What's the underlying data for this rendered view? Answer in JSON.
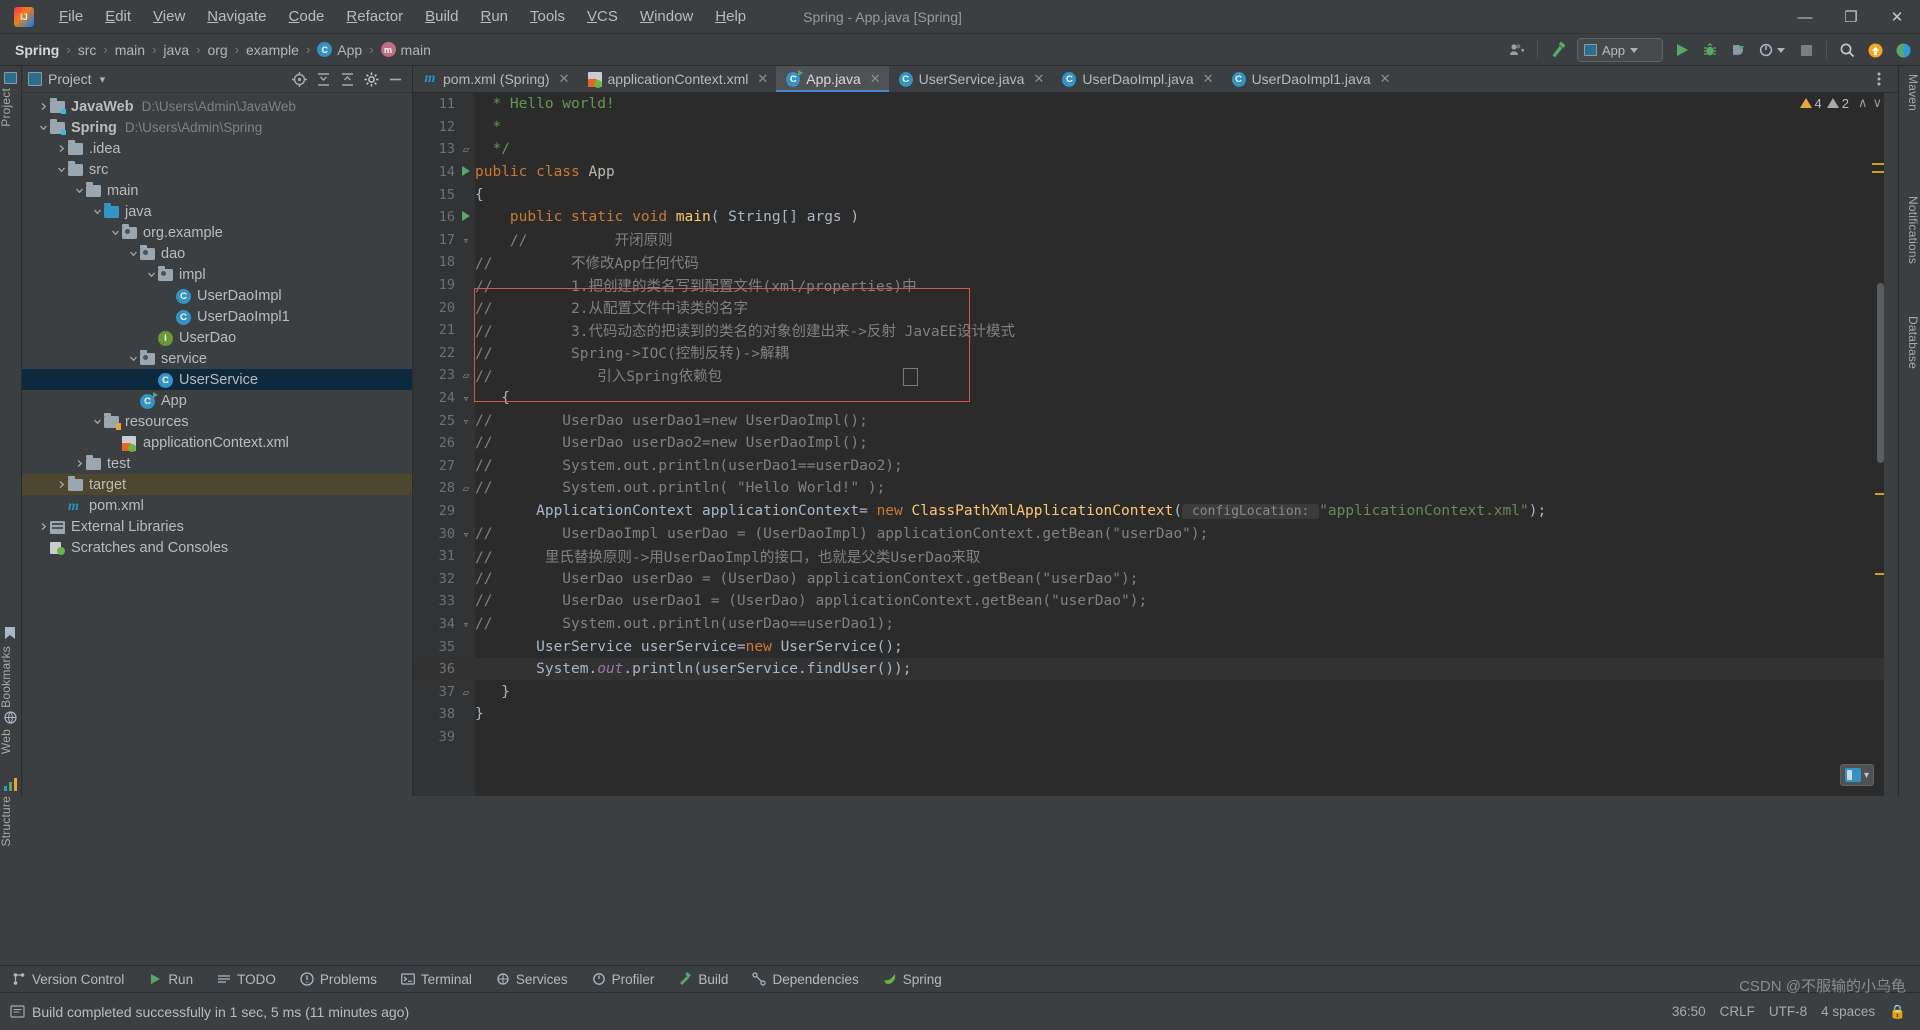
{
  "titlebar": {
    "logo": "intellij-logo",
    "menus": [
      "File",
      "Edit",
      "View",
      "Navigate",
      "Code",
      "Refactor",
      "Build",
      "Run",
      "Tools",
      "VCS",
      "Window",
      "Help"
    ],
    "window_title": "Spring - App.java [Spring]",
    "minimize": "—",
    "maximize": "❐",
    "close": "✕"
  },
  "breadcrumb": {
    "items": [
      {
        "label": "Spring",
        "bold": true,
        "icon": ""
      },
      {
        "label": "src",
        "bold": false,
        "icon": ""
      },
      {
        "label": "main",
        "bold": false,
        "icon": ""
      },
      {
        "label": "java",
        "bold": false,
        "icon": ""
      },
      {
        "label": "org",
        "bold": false,
        "icon": ""
      },
      {
        "label": "example",
        "bold": false,
        "icon": ""
      },
      {
        "label": "App",
        "bold": false,
        "icon": "class-icon"
      },
      {
        "label": "main",
        "bold": false,
        "icon": "method-icon"
      }
    ],
    "separator": "›"
  },
  "toolbar": {
    "user_icon": "user-dropdown-icon",
    "hammer_icon": "build-hammer-icon",
    "run_config": "App",
    "run_icon": "run-icon",
    "debug_icon": "debug-icon",
    "coverage_icon": "run-with-coverage-icon",
    "profiler_icon": "profiler-icon",
    "stop_icon": "stop-icon",
    "search_icon": "search-everywhere-icon",
    "updates_icon": "updates-icon",
    "settings_icon": "ide-settings-icon"
  },
  "left_strip": {
    "items": [
      "Project",
      "Bookmarks",
      "Web",
      "Structure"
    ]
  },
  "right_strip": {
    "items": [
      "Maven",
      "Notifications",
      "Database"
    ]
  },
  "project_panel": {
    "title": "Project",
    "chevron": "▾",
    "actions": [
      "locate-icon",
      "expand-all-icon",
      "collapse-all-icon",
      "settings-gear-icon",
      "hide-icon"
    ],
    "tree": [
      {
        "depth": 0,
        "label": "JavaWeb",
        "path": "D:\\Users\\Admin\\JavaWeb",
        "icon": "module-folder-icon",
        "arrow": "right",
        "bold": true
      },
      {
        "depth": 0,
        "label": "Spring",
        "path": "D:\\Users\\Admin\\Spring",
        "icon": "module-folder-icon",
        "arrow": "down",
        "bold": true
      },
      {
        "depth": 1,
        "label": ".idea",
        "path": "",
        "icon": "folder-icon",
        "arrow": "right",
        "bold": false
      },
      {
        "depth": 1,
        "label": "src",
        "path": "",
        "icon": "folder-icon",
        "arrow": "down",
        "bold": false
      },
      {
        "depth": 2,
        "label": "main",
        "path": "",
        "icon": "folder-icon",
        "arrow": "down",
        "bold": false
      },
      {
        "depth": 3,
        "label": "java",
        "path": "",
        "icon": "source-folder-icon",
        "arrow": "down",
        "bold": false
      },
      {
        "depth": 4,
        "label": "org.example",
        "path": "",
        "icon": "package-icon",
        "arrow": "down",
        "bold": false
      },
      {
        "depth": 5,
        "label": "dao",
        "path": "",
        "icon": "package-icon",
        "arrow": "down",
        "bold": false
      },
      {
        "depth": 6,
        "label": "impl",
        "path": "",
        "icon": "package-icon",
        "arrow": "down",
        "bold": false
      },
      {
        "depth": 7,
        "label": "UserDaoImpl",
        "path": "",
        "icon": "java-class-icon",
        "arrow": "none",
        "bold": false
      },
      {
        "depth": 7,
        "label": "UserDaoImpl1",
        "path": "",
        "icon": "java-class-icon",
        "arrow": "none",
        "bold": false
      },
      {
        "depth": 6,
        "label": "UserDao",
        "path": "",
        "icon": "java-interface-icon",
        "arrow": "none",
        "bold": false
      },
      {
        "depth": 5,
        "label": "service",
        "path": "",
        "icon": "package-icon",
        "arrow": "down",
        "bold": false
      },
      {
        "depth": 6,
        "label": "UserService",
        "path": "",
        "icon": "java-class-icon",
        "arrow": "none",
        "bold": false,
        "selected": true
      },
      {
        "depth": 5,
        "label": "App",
        "path": "",
        "icon": "java-runnable-class-icon",
        "arrow": "none",
        "bold": false
      },
      {
        "depth": 3,
        "label": "resources",
        "path": "",
        "icon": "resources-folder-icon",
        "arrow": "down",
        "bold": false
      },
      {
        "depth": 4,
        "label": "applicationContext.xml",
        "path": "",
        "icon": "spring-xml-icon",
        "arrow": "none",
        "bold": false
      },
      {
        "depth": 2,
        "label": "test",
        "path": "",
        "icon": "folder-icon",
        "arrow": "right",
        "bold": false
      },
      {
        "depth": 1,
        "label": "target",
        "path": "",
        "icon": "target-folder-icon",
        "arrow": "right",
        "bold": false,
        "highlight": true
      },
      {
        "depth": 1,
        "label": "pom.xml",
        "path": "",
        "icon": "maven-icon",
        "arrow": "none",
        "bold": false
      },
      {
        "depth": 0,
        "label": "External Libraries",
        "path": "",
        "icon": "libraries-icon",
        "arrow": "right",
        "bold": false
      },
      {
        "depth": 0,
        "label": "Scratches and Consoles",
        "path": "",
        "icon": "scratches-icon",
        "arrow": "none",
        "bold": false
      }
    ]
  },
  "editor": {
    "tabs": [
      {
        "label": "pom.xml (Spring)",
        "icon": "maven-icon",
        "active": false
      },
      {
        "label": "applicationContext.xml",
        "icon": "spring-xml-icon",
        "active": false
      },
      {
        "label": "App.java",
        "icon": "java-runnable-class-icon",
        "active": true
      },
      {
        "label": "UserService.java",
        "icon": "java-class-icon",
        "active": false
      },
      {
        "label": "UserDaoImpl.java",
        "icon": "java-class-icon",
        "active": false
      },
      {
        "label": "UserDaoImpl1.java",
        "icon": "java-class-icon",
        "active": false
      }
    ],
    "tab_close": "✕",
    "more_tabs_icon": "more-options-icon",
    "inspections": {
      "warnings": "4",
      "weak_warnings": "2",
      "up_icon": "∧",
      "down_icon": "∨"
    },
    "first_line_number": 11,
    "lines": [
      {
        "n": 11,
        "mark": "",
        "tokens": [
          {
            "t": "  * Hello world!",
            "c": "doc"
          }
        ]
      },
      {
        "n": 12,
        "mark": "",
        "tokens": [
          {
            "t": "  *",
            "c": "doc"
          }
        ]
      },
      {
        "n": 13,
        "mark": "fold-end",
        "tokens": [
          {
            "t": "  */",
            "c": "doc"
          }
        ]
      },
      {
        "n": 14,
        "mark": "run",
        "tokens": [
          {
            "t": "public class ",
            "c": "kw"
          },
          {
            "t": "App",
            "c": "cls-name"
          }
        ]
      },
      {
        "n": 15,
        "mark": "",
        "tokens": [
          {
            "t": "{",
            "c": "plain"
          }
        ]
      },
      {
        "n": 16,
        "mark": "run",
        "tokens": [
          {
            "t": "    ",
            "c": "plain"
          },
          {
            "t": "public static void ",
            "c": "kw"
          },
          {
            "t": "main",
            "c": "mth"
          },
          {
            "t": "( String[] args )",
            "c": "plain"
          }
        ]
      },
      {
        "n": 17,
        "mark": "fold-open",
        "tokens": [
          {
            "t": "    //          开闭原则",
            "c": "cmt"
          }
        ]
      },
      {
        "n": 18,
        "mark": "",
        "tokens": [
          {
            "t": "//         不修改App任何代码",
            "c": "cmt"
          }
        ]
      },
      {
        "n": 19,
        "mark": "",
        "tokens": [
          {
            "t": "//         1.把创建的类名写到配置文件(xml/properties)中",
            "c": "cmt"
          }
        ]
      },
      {
        "n": 20,
        "mark": "",
        "tokens": [
          {
            "t": "//         2.从配置文件中读类的名字",
            "c": "cmt"
          }
        ]
      },
      {
        "n": 21,
        "mark": "",
        "tokens": [
          {
            "t": "//         3.代码动态的把读到的类名的对象创建出来->反射 JavaEE设计模式",
            "c": "cmt"
          }
        ]
      },
      {
        "n": 22,
        "mark": "",
        "tokens": [
          {
            "t": "//         Spring->IOC(控制反转)->解耦",
            "c": "cmt"
          }
        ]
      },
      {
        "n": 23,
        "mark": "fold-end",
        "tokens": [
          {
            "t": "//            引入Spring依赖包",
            "c": "cmt"
          }
        ]
      },
      {
        "n": 24,
        "mark": "fold-open",
        "tokens": [
          {
            "t": "   {",
            "c": "plain"
          }
        ]
      },
      {
        "n": 25,
        "mark": "fold-open",
        "tokens": [
          {
            "t": "//        UserDao userDao1=new UserDaoImpl();",
            "c": "cmt"
          }
        ]
      },
      {
        "n": 26,
        "mark": "",
        "tokens": [
          {
            "t": "//        UserDao userDao2=new UserDaoImpl();",
            "c": "cmt"
          }
        ]
      },
      {
        "n": 27,
        "mark": "",
        "tokens": [
          {
            "t": "//        System.out.println(userDao1==userDao2);",
            "c": "cmt"
          }
        ]
      },
      {
        "n": 28,
        "mark": "fold-end",
        "tokens": [
          {
            "t": "//        System.out.println( \"Hello World!\" );",
            "c": "cmt"
          }
        ]
      },
      {
        "n": 29,
        "mark": "",
        "tokens": [
          {
            "t": "       ",
            "c": "plain"
          },
          {
            "t": "ApplicationContext",
            "c": "typ"
          },
          {
            "t": " applicationContext= ",
            "c": "plain"
          },
          {
            "t": "new ",
            "c": "kw"
          },
          {
            "t": "ClassPathXmlApplicationContext",
            "c": "mth"
          },
          {
            "t": "(",
            "c": "plain"
          },
          {
            "t": " configLocation: ",
            "c": "hint"
          },
          {
            "t": "\"applicationContext.xml\"",
            "c": "str"
          },
          {
            "t": ");",
            "c": "plain"
          }
        ]
      },
      {
        "n": 30,
        "mark": "fold-open",
        "tokens": [
          {
            "t": "//        UserDaoImpl userDao = (UserDaoImpl) applicationContext.getBean(\"userDao\");",
            "c": "cmt"
          }
        ]
      },
      {
        "n": 31,
        "mark": "",
        "tokens": [
          {
            "t": "//      里氏替换原则->用UserDaoImpl的接口，也就是父类UserDao来取",
            "c": "cmt"
          }
        ]
      },
      {
        "n": 32,
        "mark": "",
        "tokens": [
          {
            "t": "//        UserDao userDao = (UserDao) applicationContext.getBean(\"userDao\");",
            "c": "cmt"
          }
        ]
      },
      {
        "n": 33,
        "mark": "",
        "tokens": [
          {
            "t": "//        UserDao userDao1 = (UserDao) applicationContext.getBean(\"userDao\");",
            "c": "cmt"
          }
        ]
      },
      {
        "n": 34,
        "mark": "fold-open",
        "tokens": [
          {
            "t": "//        System.out.println(userDao==userDao1);",
            "c": "cmt"
          }
        ]
      },
      {
        "n": 35,
        "mark": "",
        "tokens": [
          {
            "t": "       ",
            "c": "plain"
          },
          {
            "t": "UserService",
            "c": "typ"
          },
          {
            "t": " userService=",
            "c": "plain"
          },
          {
            "t": "new ",
            "c": "kw"
          },
          {
            "t": "UserService",
            "c": "typ"
          },
          {
            "t": "();",
            "c": "plain"
          }
        ]
      },
      {
        "n": 36,
        "mark": "",
        "tokens": [
          {
            "t": "       System.",
            "c": "plain"
          },
          {
            "t": "out",
            "c": "fld"
          },
          {
            "t": ".println(userService.findUser());",
            "c": "plain"
          }
        ],
        "current": true
      },
      {
        "n": 37,
        "mark": "fold-end",
        "tokens": [
          {
            "t": "   }",
            "c": "plain"
          }
        ]
      },
      {
        "n": 38,
        "mark": "",
        "tokens": [
          {
            "t": "}",
            "c": "plain"
          }
        ]
      },
      {
        "n": 39,
        "mark": "",
        "tokens": []
      }
    ],
    "annotation": {
      "redbox_label": "red-highlight-box"
    },
    "float_widget": {
      "icon": "ime-indicator-icon",
      "chevron": "▾"
    }
  },
  "bottom_tools": [
    {
      "label": "Version Control",
      "icon": "branch-icon"
    },
    {
      "label": "Run",
      "icon": "run-icon"
    },
    {
      "label": "TODO",
      "icon": "todo-icon"
    },
    {
      "label": "Problems",
      "icon": "problems-icon"
    },
    {
      "label": "Terminal",
      "icon": "terminal-icon"
    },
    {
      "label": "Services",
      "icon": "services-icon"
    },
    {
      "label": "Profiler",
      "icon": "profiler-icon"
    },
    {
      "label": "Build",
      "icon": "build-hammer-icon"
    },
    {
      "label": "Dependencies",
      "icon": "dependencies-icon"
    },
    {
      "label": "Spring",
      "icon": "spring-leaf-icon"
    }
  ],
  "statusbar": {
    "icon": "event-log-icon",
    "message": "Build completed successfully in 1 sec, 5 ms (11 minutes ago)",
    "caret": "36:50",
    "line_sep": "CRLF",
    "encoding": "UTF-8",
    "indent": "4 spaces",
    "lock": "🔒",
    "watermark": "CSDN @不服输的小乌龟"
  },
  "colors": {
    "accent_blue": "#4a88c7",
    "selection": "#0d293e",
    "warn_yellow": "#e8a33d",
    "green_run": "#59a869",
    "red_box": "#d9534f",
    "editor_bg": "#2b2b2b",
    "panel_bg": "#3c3f41"
  }
}
